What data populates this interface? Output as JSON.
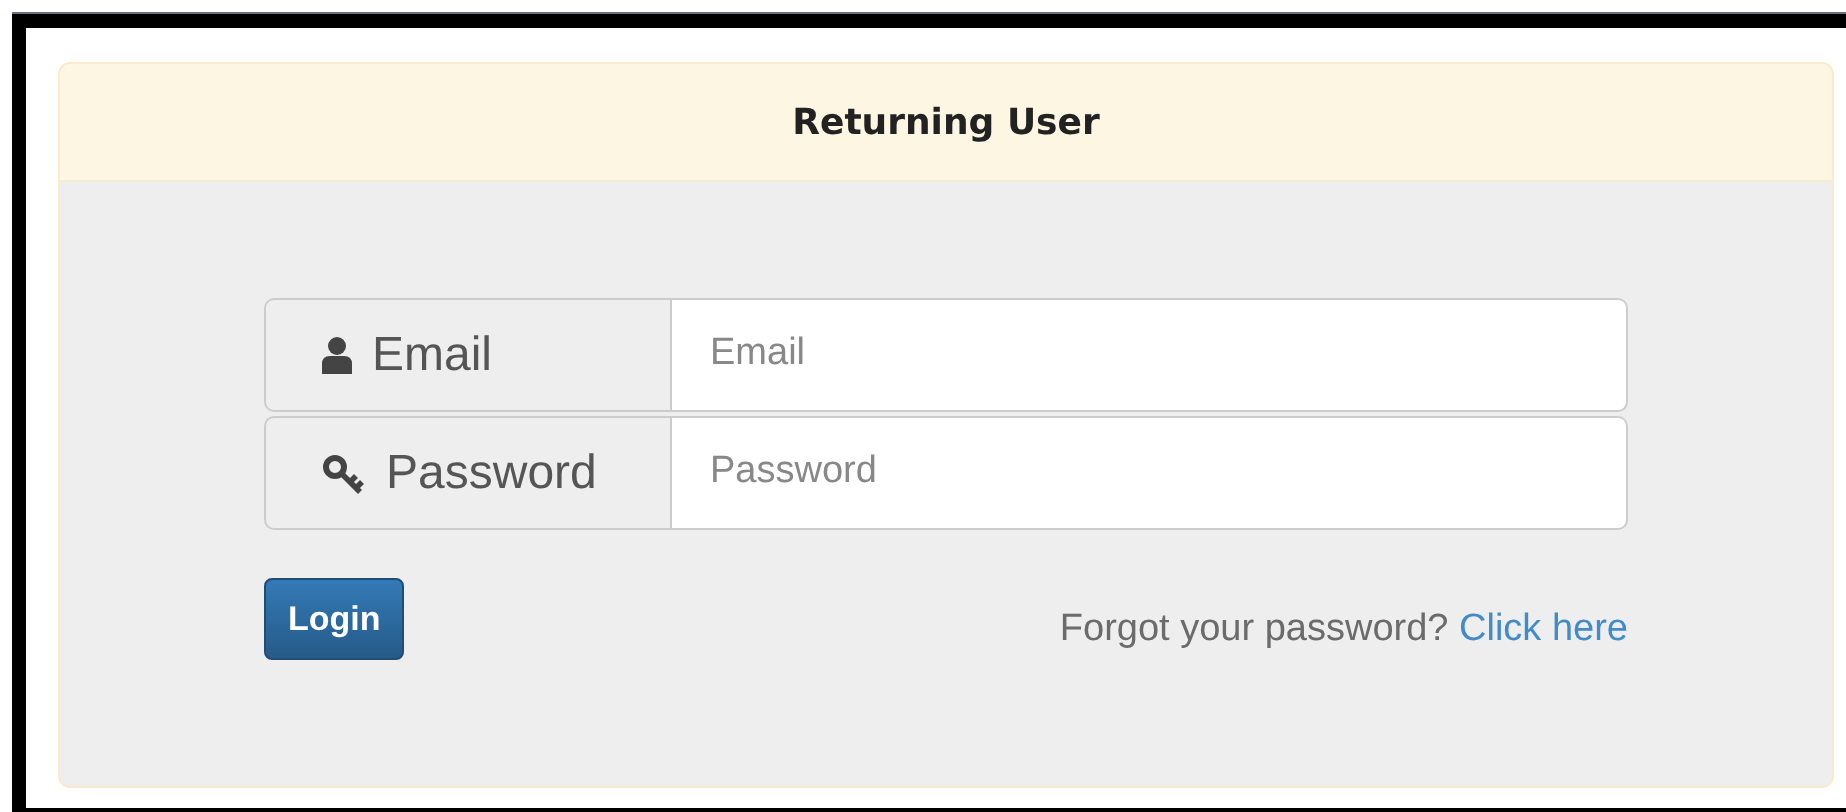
{
  "panel": {
    "title": "Returning User"
  },
  "fields": [
    {
      "label": "Email",
      "kind": "person",
      "placeholder": "Email"
    },
    {
      "label": "Password",
      "kind": "key",
      "placeholder": "Password"
    }
  ],
  "login_button": "Login",
  "forgot": {
    "text": "Forgot your password?",
    "link": "Click here"
  }
}
